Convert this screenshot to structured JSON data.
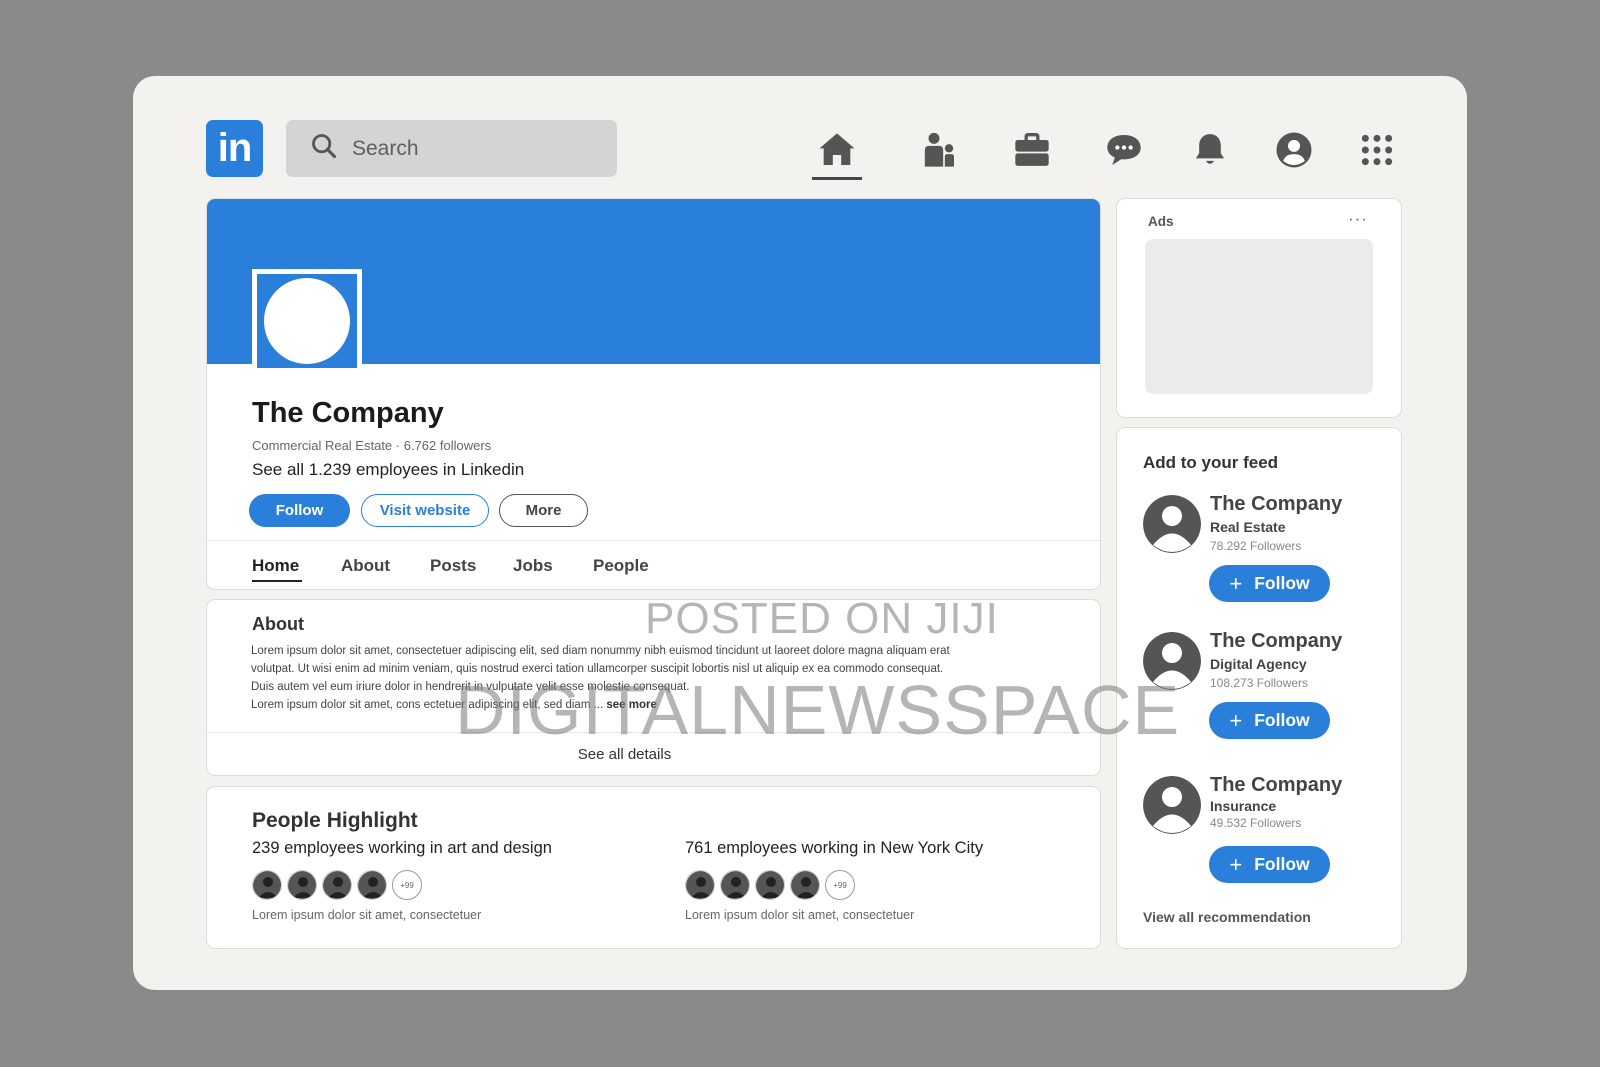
{
  "header": {
    "logo_text": "in",
    "search_placeholder": "Search",
    "nav": [
      {
        "name": "home-icon",
        "active": true
      },
      {
        "name": "network-icon",
        "active": false
      },
      {
        "name": "jobs-icon",
        "active": false
      },
      {
        "name": "messaging-icon",
        "active": false
      },
      {
        "name": "notifications-icon",
        "active": false
      },
      {
        "name": "profile-icon",
        "active": false
      },
      {
        "name": "apps-grid-icon",
        "active": false
      }
    ]
  },
  "colors": {
    "brand": "#2a7fda",
    "page_bg": "#f3f2ef",
    "outer_bg": "#898b8a"
  },
  "company": {
    "name": "The Company",
    "meta": "Commercial Real Estate · 6.762 followers",
    "employees_link": "See all 1.239 employees in Linkedin",
    "buttons": {
      "follow": "Follow",
      "visit_website": "Visit website",
      "more": "More"
    },
    "tabs": [
      "Home",
      "About",
      "Posts",
      "Jobs",
      "People"
    ],
    "active_tab": "Home"
  },
  "about": {
    "title": "About",
    "lines": [
      "Lorem ipsum dolor sit amet, consectetuer adipiscing elit, sed diam nonummy nibh euismod tincidunt ut laoreet dolore magna aliquam erat",
      "volutpat. Ut wisi enim ad minim veniam, quis nostrud exerci tation ullamcorper suscipit lobortis nisl ut aliquip ex ea commodo consequat.",
      "Duis autem vel eum iriure dolor in hendrerit in vulputate velit esse molestie consequat.",
      "Lorem ipsum dolor sit amet, cons ectetuer adipiscing elit, sed diam ..."
    ],
    "see_more": "see more",
    "see_all": "See all details"
  },
  "people_highlight": {
    "title": "People Highlight",
    "groups": [
      {
        "title": "239 employees working in art and design",
        "more_badge": "+99",
        "caption": "Lorem ipsum dolor sit amet, consectetuer"
      },
      {
        "title": "761 employees working in New York City",
        "more_badge": "+99",
        "caption": "Lorem ipsum dolor sit amet, consectetuer"
      }
    ]
  },
  "ads": {
    "label": "Ads",
    "menu": "···"
  },
  "feed": {
    "title": "Add to your feed",
    "recommendations": [
      {
        "name": "The Company",
        "industry": "Real Estate",
        "followers": "78.292 Followers",
        "button": "Follow"
      },
      {
        "name": "The Company",
        "industry": "Digital Agency",
        "followers": "108.273 Followers",
        "button": "Follow"
      },
      {
        "name": "The Company",
        "industry": "Insurance",
        "followers": "49.532 Followers",
        "button": "Follow"
      }
    ],
    "view_all": "View all recommendation"
  },
  "watermark": {
    "line1": "POSTED ON JIJI",
    "line2": "DIGITALNEWSSPACE"
  }
}
